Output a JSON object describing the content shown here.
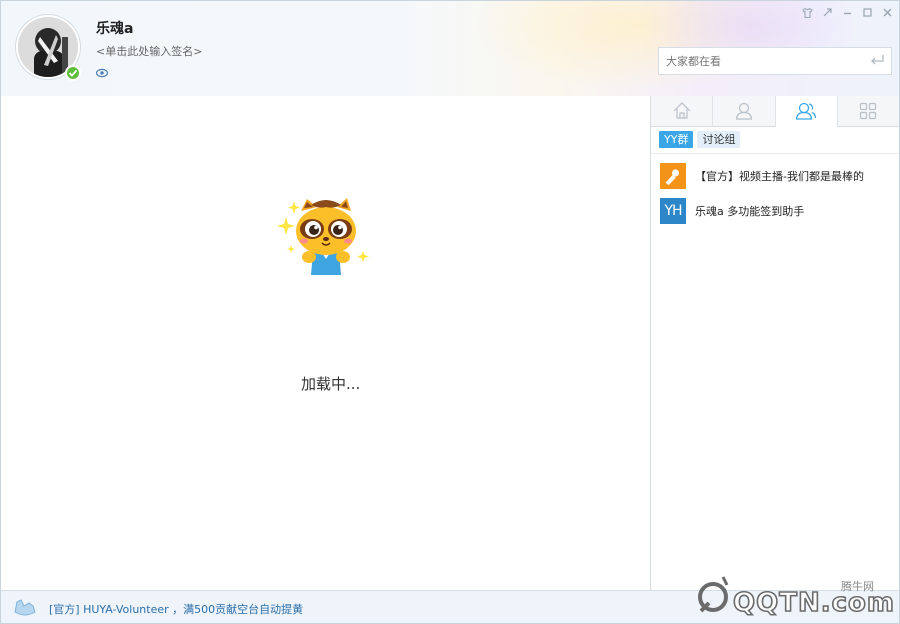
{
  "user": {
    "nickname": "乐魂a",
    "signature": "<单击此处输入签名>",
    "status": "online"
  },
  "search": {
    "placeholder": "大家都在看"
  },
  "window_controls": [
    "skin-icon",
    "restore-icon",
    "minimize-icon",
    "maximize-icon",
    "close-icon"
  ],
  "right_tabs": [
    {
      "icon": "home-icon",
      "active": false
    },
    {
      "icon": "contact-icon",
      "active": false
    },
    {
      "icon": "group-icon",
      "active": true
    },
    {
      "icon": "apps-icon",
      "active": false
    }
  ],
  "subtabs": [
    {
      "label": "YY群",
      "active": true
    },
    {
      "label": "讨论组",
      "active": false
    }
  ],
  "groups": [
    {
      "name": "【官方】视频主播-我们都是最棒的",
      "icon": "microphone-icon",
      "color": "#f39317"
    },
    {
      "name": "乐魂a 多功能签到助手",
      "icon_text": "YH",
      "color": "#2c86c8"
    }
  ],
  "main": {
    "loading_text": "加载中..."
  },
  "footer": {
    "notice": "[官方] HUYA-Volunteer ，满500贡献空台自动提黄"
  },
  "watermark": {
    "text": "QQTN.com",
    "small": "腾牛网"
  },
  "colors": {
    "accent": "#3aa6e8",
    "online": "#5fbf3c",
    "orange": "#f39317",
    "blue": "#2c86c8"
  }
}
